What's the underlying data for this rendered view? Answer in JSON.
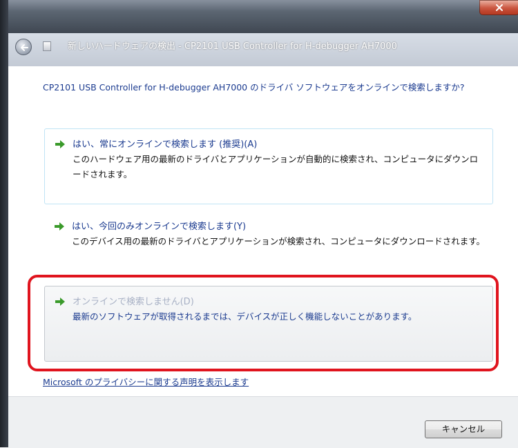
{
  "window": {
    "title": "新しいハードウェアの検出 - CP2101 USB Controller for H-debugger AH7000",
    "close_symbol": "x"
  },
  "prompt": "CP2101 USB Controller for H-debugger AH7000 のドライバ ソフトウェアをオンラインで検索しますか?",
  "options": [
    {
      "heading": "はい、常にオンラインで検索します (推奨)(A)",
      "description": "このハードウェア用の最新のドライバとアプリケーションが自動的に検索され、コンピュータにダウンロードされます。",
      "icon": "green-arrow-icon",
      "enabled": true
    },
    {
      "heading": "はい、今回のみオンラインで検索します(Y)",
      "description": "このデバイス用の最新のドライバとアプリケーションが検索され、コンピュータにダウンロードされます。",
      "icon": "green-arrow-icon",
      "enabled": true
    },
    {
      "heading": "オンラインで検索しません(D)",
      "description": "最新のソフトウェアが取得されるまでは、デバイスが正しく機能しないことがあります。",
      "icon": "green-arrow-icon",
      "enabled": true,
      "highlighted": true
    }
  ],
  "privacy_link": "Microsoft のプライバシーに関する声明を表示します",
  "footer": {
    "cancel_label": "キャンセル"
  },
  "colors": {
    "link_blue": "#1a3a8f",
    "highlight_red": "#e0141e",
    "arrow_green": "#3a9a2a"
  }
}
